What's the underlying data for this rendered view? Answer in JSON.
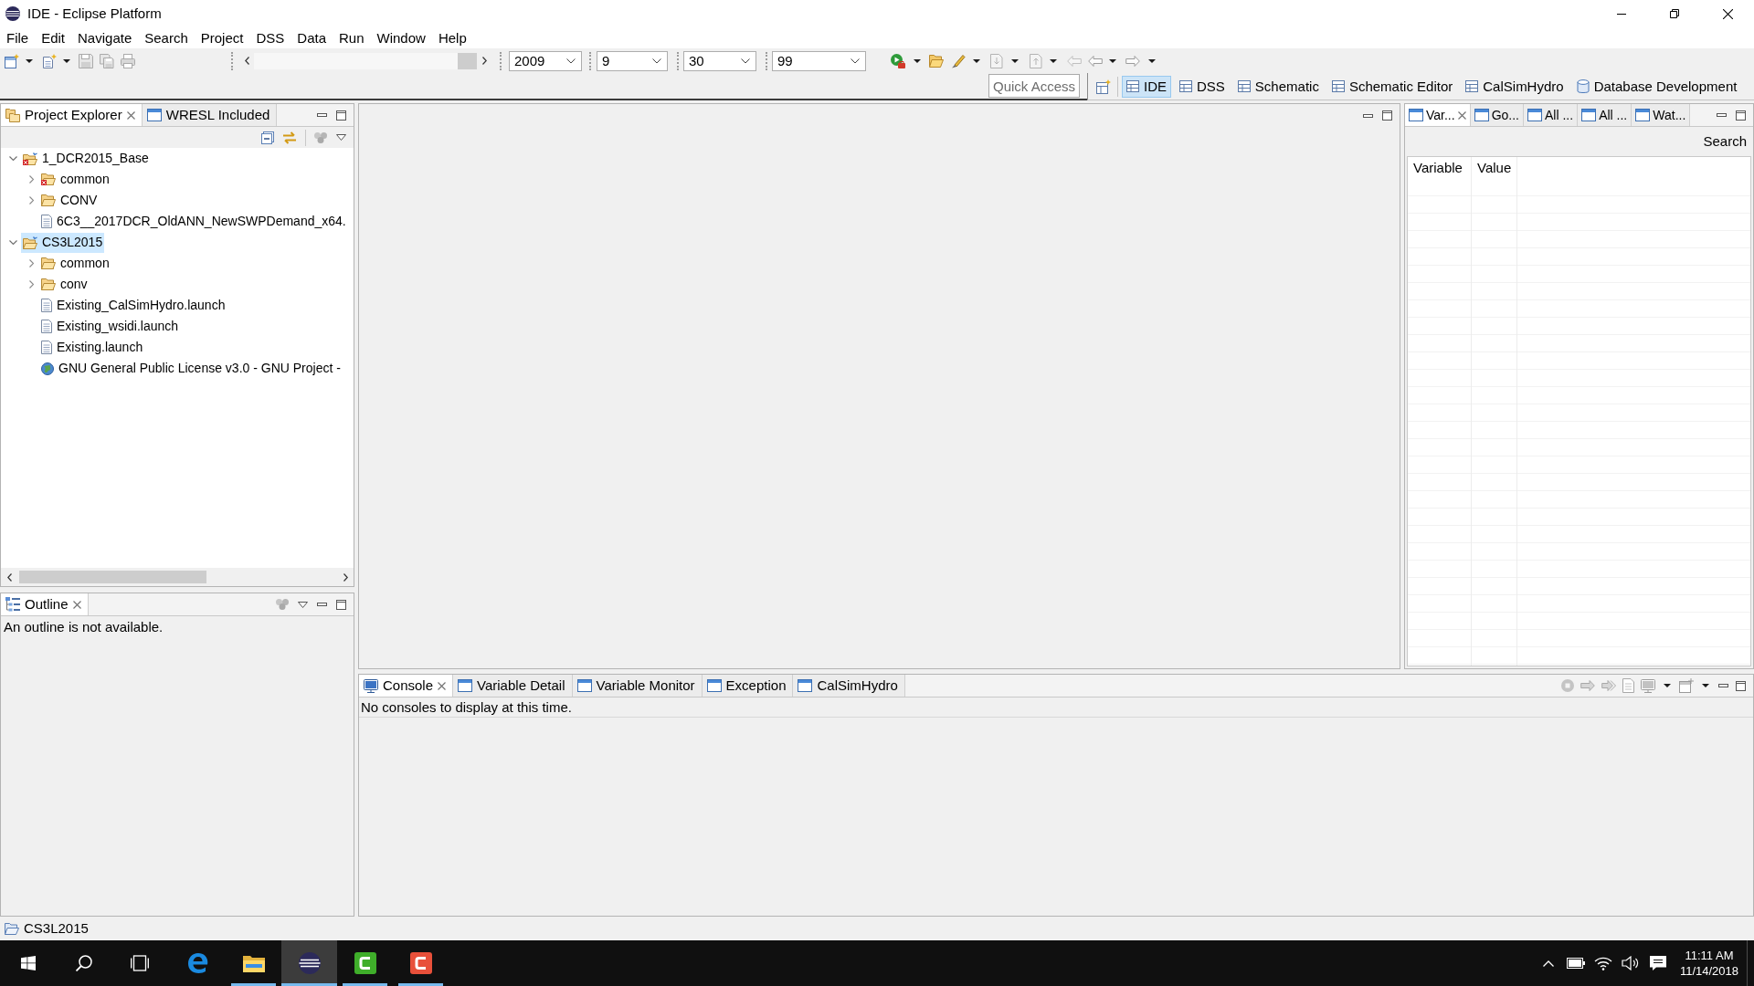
{
  "window": {
    "title": "IDE - Eclipse Platform"
  },
  "menu_bar": [
    "File",
    "Edit",
    "Navigate",
    "Search",
    "Project",
    "DSS",
    "Data",
    "Run",
    "Window",
    "Help"
  ],
  "main_toolbar": {
    "slider": {
      "level": 1
    },
    "combos": [
      {
        "value": "2009"
      },
      {
        "value": "9"
      },
      {
        "value": "30"
      },
      {
        "value": "99"
      }
    ]
  },
  "quick_access": {
    "placeholder": "Quick Access"
  },
  "perspectives": [
    {
      "label": "IDE",
      "kind": "table",
      "selected": true
    },
    {
      "label": "DSS",
      "kind": "table",
      "selected": false
    },
    {
      "label": "Schematic",
      "kind": "table",
      "selected": false
    },
    {
      "label": "Schematic Editor",
      "kind": "table",
      "selected": false
    },
    {
      "label": "CalSimHydro",
      "kind": "table",
      "selected": false
    },
    {
      "label": "Database Development",
      "kind": "database",
      "selected": false
    }
  ],
  "project_explorer": {
    "tabs": [
      {
        "label": "Project Explorer",
        "kind": "explorer",
        "selected": true
      },
      {
        "label": "WRESL Included",
        "kind": "view",
        "selected": false
      }
    ],
    "tree": [
      {
        "label": "1_DCR2015_Base",
        "kind": "project",
        "error": true,
        "expanded": true,
        "selected": false,
        "children": [
          {
            "label": "common",
            "kind": "folder",
            "error": true,
            "expanded": false,
            "selected": false
          },
          {
            "label": "CONV",
            "kind": "folder",
            "error": false,
            "expanded": false,
            "selected": false
          },
          {
            "label": "6C3__2017DCR_OldANN_NewSWPDemand_x64.",
            "kind": "file",
            "error": false,
            "selected": false
          }
        ]
      },
      {
        "label": "CS3L2015",
        "kind": "project",
        "error": false,
        "expanded": true,
        "selected": true,
        "children": [
          {
            "label": "common",
            "kind": "folder",
            "error": false,
            "expanded": false,
            "selected": false
          },
          {
            "label": "conv",
            "kind": "folder",
            "error": false,
            "expanded": false,
            "selected": false
          },
          {
            "label": "Existing_CalSimHydro.launch",
            "kind": "file",
            "error": false,
            "selected": false
          },
          {
            "label": "Existing_wsidi.launch",
            "kind": "file",
            "error": false,
            "selected": false
          },
          {
            "label": "Existing.launch",
            "kind": "file",
            "error": false,
            "selected": false
          },
          {
            "label": "GNU General Public License v3.0 - GNU Project -",
            "kind": "link",
            "error": false,
            "selected": false
          }
        ]
      }
    ]
  },
  "outline": {
    "tabs": [
      {
        "label": "Outline",
        "kind": "outline",
        "selected": true
      }
    ],
    "message": "An outline is not available."
  },
  "variables_view": {
    "tabs": [
      {
        "label": "Var...",
        "kind": "view",
        "selected": true
      },
      {
        "label": "Go...",
        "kind": "view",
        "selected": false
      },
      {
        "label": "All ...",
        "kind": "view",
        "selected": false
      },
      {
        "label": "All ...",
        "kind": "view",
        "selected": false
      },
      {
        "label": "Wat...",
        "kind": "view",
        "selected": false
      }
    ],
    "toolbar_action": "Search",
    "table": {
      "columns": [
        "Variable",
        "Value"
      ]
    }
  },
  "console": {
    "tabs": [
      {
        "label": "Console",
        "kind": "console",
        "selected": true
      },
      {
        "label": "Variable Detail",
        "kind": "view",
        "selected": false
      },
      {
        "label": "Variable Monitor",
        "kind": "view",
        "selected": false
      },
      {
        "label": "Exception",
        "kind": "view",
        "selected": false
      },
      {
        "label": "CalSimHydro",
        "kind": "view",
        "selected": false
      }
    ],
    "message": "No consoles to display at this time."
  },
  "status_bar": {
    "text": "CS3L2015"
  },
  "taskbar": {
    "apps": [
      {
        "kind": "edge",
        "running": false,
        "selected": false
      },
      {
        "kind": "explorer",
        "running": true,
        "selected": false
      },
      {
        "kind": "eclipse",
        "running": true,
        "selected": true
      },
      {
        "kind": "camtasia",
        "running": true,
        "selected": false
      },
      {
        "kind": "recorder",
        "running": true,
        "selected": false
      }
    ],
    "clock": {
      "time": "11:11 AM",
      "date": "11/14/2018"
    }
  }
}
